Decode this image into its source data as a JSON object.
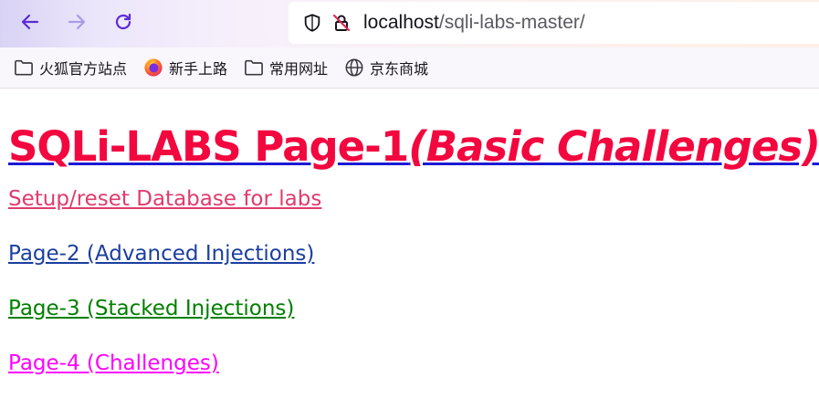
{
  "browser": {
    "url_host": "localhost",
    "url_path": "/sqli-labs-master/"
  },
  "bookmarks": [
    {
      "label": "火狐官方站点",
      "icon": "folder-icon"
    },
    {
      "label": "新手上路",
      "icon": "firefox-icon"
    },
    {
      "label": "常用网址",
      "icon": "folder-icon"
    },
    {
      "label": "京东商城",
      "icon": "globe-icon"
    }
  ],
  "page": {
    "title_main": "SQLi-LABS Page-1",
    "title_sub": "(Basic Challenges)",
    "links": [
      {
        "label": "Setup/reset Database for labs",
        "color": "#e03b6c"
      },
      {
        "label": "Page-2 (Advanced Injections)",
        "color": "#1b3fa0"
      },
      {
        "label": "Page-3 (Stacked Injections)",
        "color": "#008000"
      },
      {
        "label": "Page-4 (Challenges)",
        "color": "#ff00ff"
      }
    ]
  },
  "colors": {
    "title": "#f3073f",
    "title_underline": "#1a1ad6",
    "accent": "#5b2bd6"
  }
}
